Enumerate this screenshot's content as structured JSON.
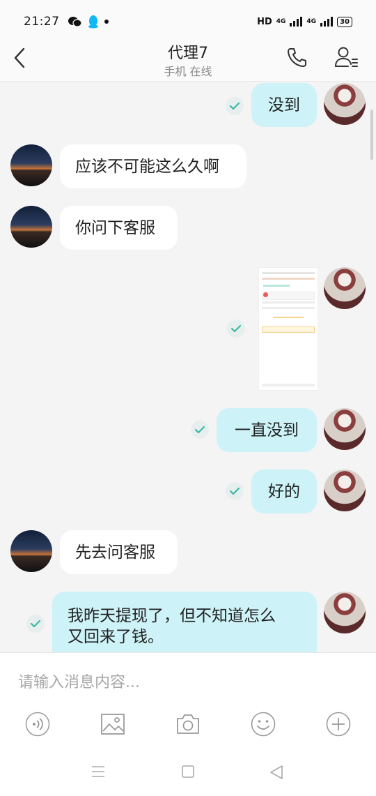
{
  "status_bar": {
    "time": "21:27",
    "network": "HD",
    "signal1": "4G",
    "signal2": "4G",
    "battery": "30"
  },
  "header": {
    "title": "代理7",
    "subtitle": "手机 在线"
  },
  "messages": [
    {
      "from": "me",
      "text": "没到"
    },
    {
      "from": "other",
      "text": "应该不可能这么久啊"
    },
    {
      "from": "other",
      "text": "你问下客服"
    },
    {
      "from": "me",
      "type": "image"
    },
    {
      "from": "me",
      "text": "一直没到"
    },
    {
      "from": "me",
      "text": "好的"
    },
    {
      "from": "other",
      "text": "先去问客服"
    },
    {
      "from": "me",
      "text_line1": "我昨天提现了，但不知道怎么",
      "text_line2": "又回来了钱。"
    }
  ],
  "input": {
    "placeholder": "请输入消息内容..."
  },
  "toolbar_icons": [
    "voice-icon",
    "image-icon",
    "camera-icon",
    "emoji-icon",
    "plus-icon"
  ],
  "colors": {
    "my_bubble": "#cdf2f7",
    "other_bubble": "#ffffff",
    "check": "#3bb8a4"
  }
}
